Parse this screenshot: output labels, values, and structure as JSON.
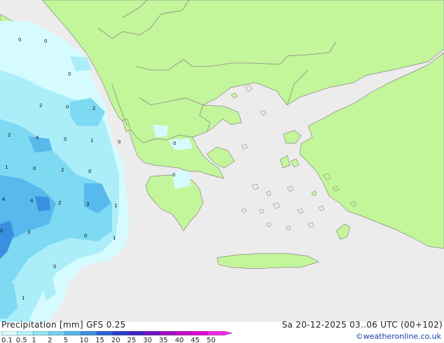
{
  "map": {
    "sea_color": "#ececec",
    "land_color": "#c3f59a",
    "coast_color": "#8a8a8a",
    "precip_colors": [
      "#d5fbfe",
      "#abeefa",
      "#7ed9f2",
      "#57b9ec",
      "#3a8fe0"
    ],
    "values": [
      {
        "label": "0"
      },
      {
        "label": "0"
      },
      {
        "label": "0"
      },
      {
        "label": "0"
      },
      {
        "label": "2"
      },
      {
        "label": "2"
      },
      {
        "label": "2"
      },
      {
        "label": "4"
      },
      {
        "label": "0"
      },
      {
        "label": "1"
      },
      {
        "label": "0"
      },
      {
        "label": "0"
      },
      {
        "label": "1"
      },
      {
        "label": "0"
      },
      {
        "label": "2"
      },
      {
        "label": "0"
      },
      {
        "label": "0"
      },
      {
        "label": "4"
      },
      {
        "label": "4"
      },
      {
        "label": "2"
      },
      {
        "label": "3"
      },
      {
        "label": "1"
      },
      {
        "label": "3"
      },
      {
        "label": "0"
      },
      {
        "label": "1"
      },
      {
        "label": "0"
      },
      {
        "label": "0"
      },
      {
        "label": "1"
      }
    ]
  },
  "footer": {
    "title": "Precipitation [mm]  GFS 0.25",
    "time": "Sa 20-12-2025 03..06 UTC (00+102)",
    "credit": "©weatheronline.co.uk"
  },
  "scale": {
    "labels": [
      "0.1",
      "0.5",
      "1",
      "2",
      "5",
      "10",
      "15",
      "20",
      "25",
      "30",
      "35",
      "40",
      "45",
      "50"
    ],
    "colors": [
      "#d9fcfe",
      "#b4f2fb",
      "#93e3f6",
      "#74d3f2",
      "#4fb6ea",
      "#3d8ee2",
      "#2e63d8",
      "#2a3ecd",
      "#3a22c6",
      "#7312c6",
      "#a10dc6",
      "#c60ac6",
      "#e20ad8",
      "#f52ae8"
    ]
  }
}
